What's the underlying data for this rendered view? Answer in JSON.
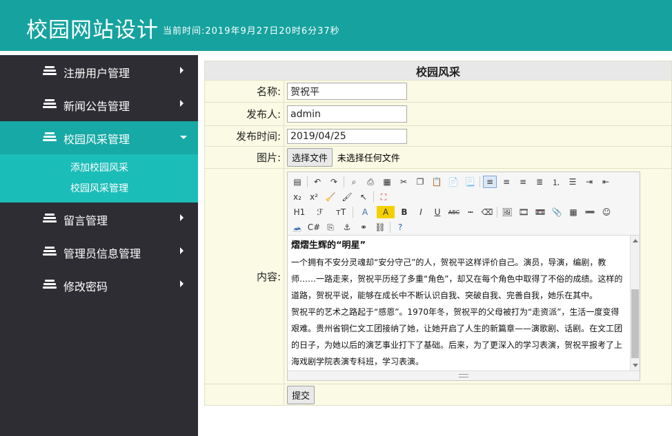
{
  "header": {
    "title": "校园网站设计",
    "time_text": "当前时间:2019年9月27日20时6分37秒"
  },
  "sidebar": {
    "items": [
      {
        "label": "注册用户管理"
      },
      {
        "label": "新闻公告管理"
      },
      {
        "label": "校园风采管理"
      },
      {
        "label": "留言管理"
      },
      {
        "label": "管理员信息管理"
      },
      {
        "label": "修改密码"
      }
    ],
    "submenu": [
      {
        "label": "添加校园风采"
      },
      {
        "label": "校园风采管理"
      }
    ]
  },
  "form": {
    "caption": "校园风采",
    "name_label": "名称:",
    "name_value": "贺祝平",
    "publisher_label": "发布人:",
    "publisher_value": "admin",
    "time_label": "发布时间:",
    "time_value": "2019/04/25",
    "image_label": "图片:",
    "choose_file": "选择文件",
    "no_file": "未选择任何文件",
    "content_label": "内容:",
    "submit": "提交"
  },
  "editor": {
    "heading": "熠熠生辉的“明星”",
    "paragraphs": [
      "一个拥有不安分灵魂却“安分守己”的人，贺祝平这样评价自己。演员，导演，编剧，教师……一路走来，贺祝平历经了多重“角色”，却又在每个角色中取得了不俗的成绩。这样的道路，贺祝平说，能够在成长中不断认识自我、突破自我、完善自我，她乐在其中。",
      "贺祝平的艺术之路起于“感恩”。1970年冬，贺祝平的父母被打为“走资派”，生活一度变得艰难。贵州省铜仁文工团接纳了她，让她开启了人生的新篇章——演歌剧、话剧。在文工团的日子，为她以后的演艺事业打下了基础。后来，为了更深入的学习表演，贺祝平报考了上海戏剧学院表演专科班，学习表演。"
    ],
    "toolbar_text": {
      "h1": "H1",
      "font": "ℱ",
      "size": "тT",
      "fontcolor": "A",
      "bgcolor": "A",
      "bold": "B",
      "italic": "I",
      "underline": "U",
      "strike": "ABC"
    }
  }
}
